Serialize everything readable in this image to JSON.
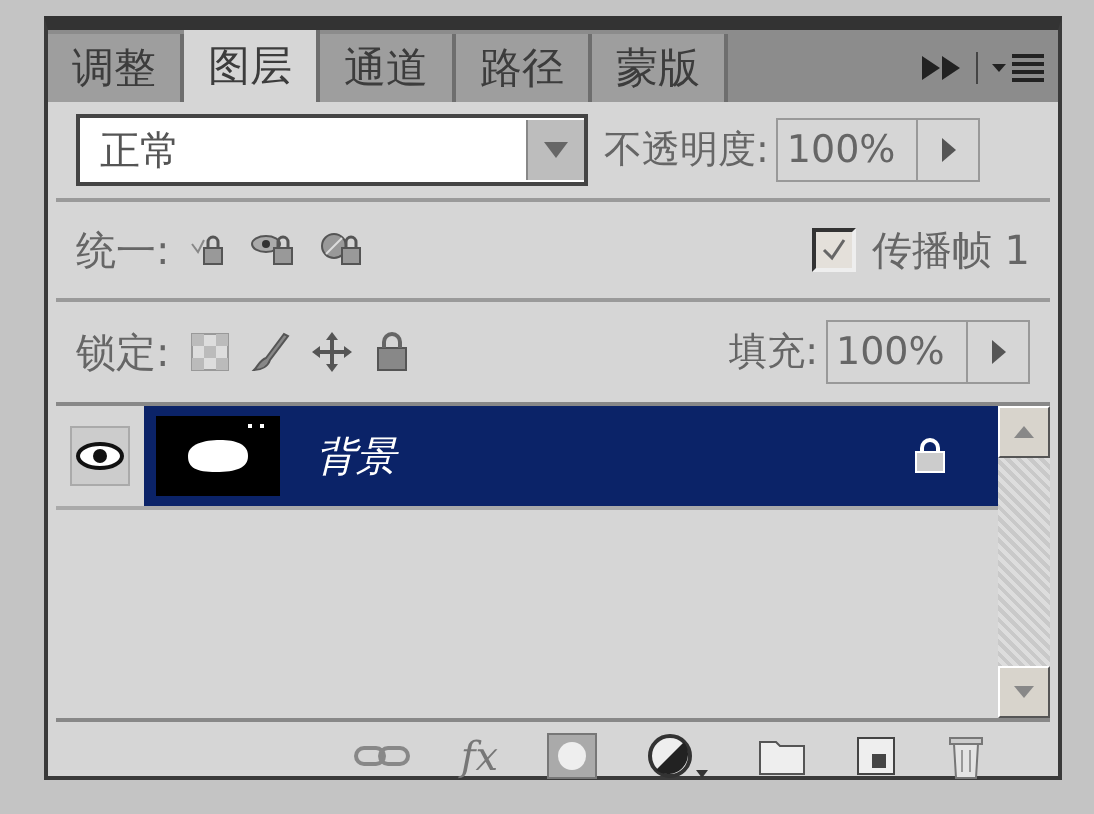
{
  "tabs": [
    {
      "label": "调整",
      "selected": false
    },
    {
      "label": "图层",
      "selected": true
    },
    {
      "label": "通道",
      "selected": false
    },
    {
      "label": "路径",
      "selected": false
    },
    {
      "label": "蒙版",
      "selected": false
    }
  ],
  "blend_mode": {
    "value": "正常"
  },
  "opacity": {
    "label": "不透明度:",
    "value": "100%"
  },
  "unify": {
    "label": "统一:"
  },
  "propagate": {
    "label": "传播帧 1",
    "checked": true
  },
  "lock": {
    "label": "锁定:"
  },
  "fill": {
    "label": "填充:",
    "value": "100%"
  },
  "layers": [
    {
      "name": "背景",
      "visible": true,
      "selected": true,
      "locked": true
    }
  ],
  "footer": {
    "fx": "fx"
  }
}
